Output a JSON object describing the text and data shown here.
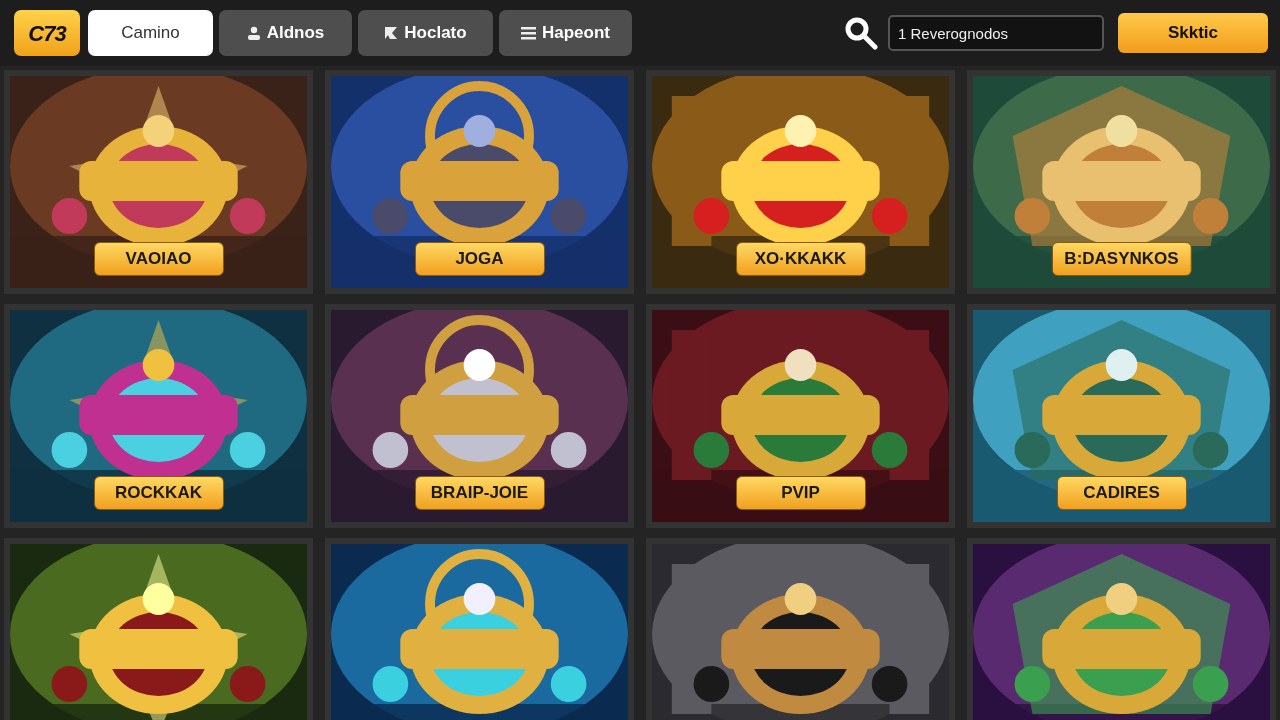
{
  "logo": "C73",
  "tabs": [
    {
      "label": "Camino",
      "selected": true
    },
    {
      "label": "Aldnos",
      "selected": false
    },
    {
      "label": "Hoclato",
      "selected": false
    },
    {
      "label": "Hapeont",
      "selected": false
    }
  ],
  "search": {
    "value": "1 Reverognodos"
  },
  "action_button": "Skktic",
  "games": [
    {
      "kind": "picture",
      "button": "VAOIAO"
    },
    {
      "kind": "picture",
      "button": "JOGA"
    },
    {
      "kind": "picture",
      "button": "XO·KKAKK"
    },
    {
      "kind": "picture",
      "button": "B:DASYNKOS"
    },
    {
      "kind": "picture",
      "button": "ROCKKAK"
    },
    {
      "kind": "picture",
      "button": "BRAIP-JOIE"
    },
    {
      "kind": "picture",
      "button": "PVIP"
    },
    {
      "kind": "picture",
      "button": "CADIRES"
    },
    {
      "kind": "picture"
    },
    {
      "kind": "picture"
    },
    {
      "kind": "picture"
    },
    {
      "kind": "picture"
    }
  ]
}
